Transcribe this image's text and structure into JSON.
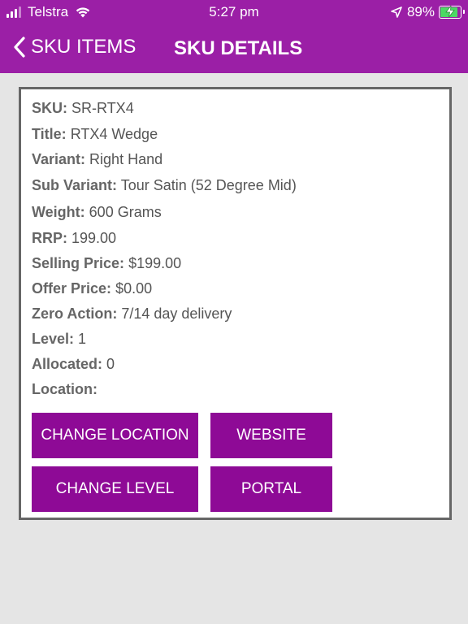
{
  "status_bar": {
    "carrier": "Telstra",
    "time": "5:27 pm",
    "battery_percent": "89%",
    "icons": [
      "signal-icon",
      "wifi-icon",
      "location-arrow-icon",
      "battery-charging-icon"
    ]
  },
  "nav": {
    "back_label": "SKU ITEMS",
    "title": "SKU DETAILS"
  },
  "fields": [
    {
      "label": "SKU:",
      "value": "SR-RTX4"
    },
    {
      "label": "Title:",
      "value": "RTX4 Wedge"
    },
    {
      "label": "Variant:",
      "value": "Right Hand"
    },
    {
      "label": "Sub Variant:",
      "value": "Tour Satin (52 Degree Mid)"
    },
    {
      "label": "Weight:",
      "value": "600 Grams"
    },
    {
      "label": "RRP:",
      "value": "199.00"
    },
    {
      "label": "Selling Price:",
      "value": "$199.00"
    },
    {
      "label": "Offer Price:",
      "value": "$0.00"
    },
    {
      "label": "Zero Action:",
      "value": "7/14 day delivery"
    },
    {
      "label": "Level:",
      "value": "1"
    },
    {
      "label": "Allocated:",
      "value": "0"
    },
    {
      "label": "Location:",
      "value": ""
    }
  ],
  "buttons": {
    "change_location": "CHANGE LOCATION",
    "website": "WEBSITE",
    "change_level": "CHANGE LEVEL",
    "portal": "PORTAL"
  },
  "colors": {
    "header": "#9b1fa6",
    "button": "#8e0a96",
    "background": "#e5e5e5",
    "card_border": "#666666"
  }
}
